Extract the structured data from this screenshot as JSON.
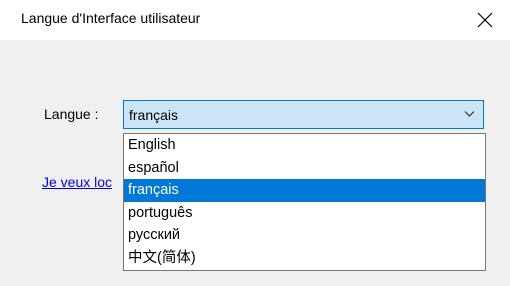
{
  "window": {
    "title": "Langue d'Interface utilisateur",
    "close_icon": "close-icon"
  },
  "form": {
    "language_label": "Langue :",
    "selected_language": "français",
    "dropdown_icon": "chevron-down-icon",
    "link_text": "Je veux loc"
  },
  "dropdown": {
    "options": [
      {
        "label": "English",
        "selected": false
      },
      {
        "label": "español",
        "selected": false
      },
      {
        "label": "français",
        "selected": true
      },
      {
        "label": "português",
        "selected": false
      },
      {
        "label": "русский",
        "selected": false
      },
      {
        "label": "中文(简体)",
        "selected": false
      }
    ]
  },
  "colors": {
    "accent": "#0078d7",
    "combo_background": "#cce4f7",
    "link": "#0000ff",
    "dialog_background": "#f0f0f0"
  }
}
